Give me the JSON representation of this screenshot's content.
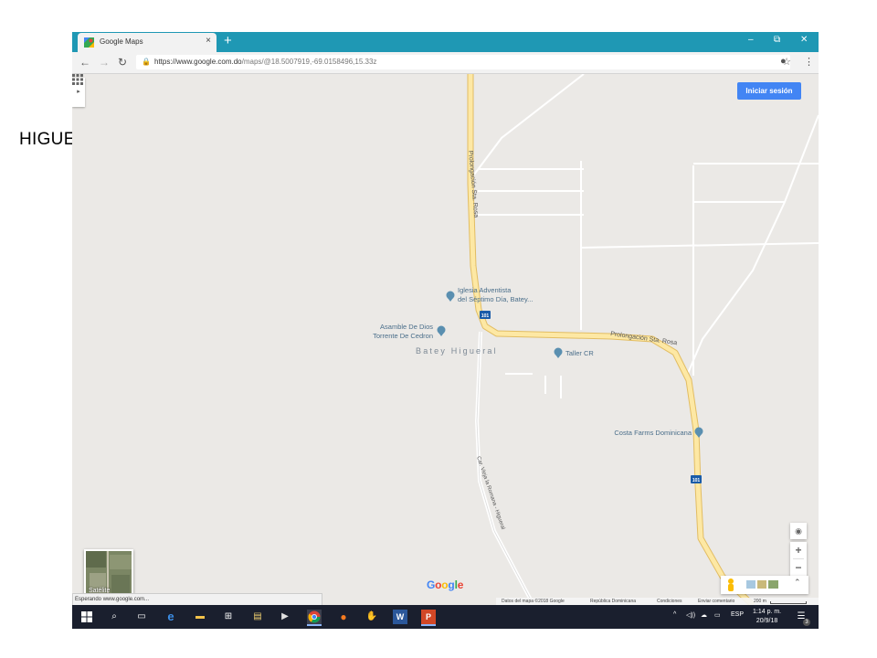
{
  "slide": {
    "title": "HIGUERAL"
  },
  "browser": {
    "tab_title": "Google Maps",
    "tab_close": "×",
    "new_tab": "+",
    "window_controls": {
      "minimize": "–",
      "restore": "⧉",
      "close": "✕"
    },
    "url_host": "https://www.google.com.do",
    "url_rest": "/maps/@18.5007919,-69.0158496,15.33z",
    "status_text": "Esperando www.google.com..."
  },
  "map": {
    "signin_label": "Iniciar sesión",
    "satellite_label": "Satélite",
    "google_logo": "Google",
    "labels": {
      "road_west": "Prolongación Sta. Rosa",
      "road_east": "Prolongación Sta. Rosa",
      "church_line1": "Iglesia Adventista",
      "church_line2": "del Séptimo Día, Batey...",
      "asamble_line1": "Asamble De Dios",
      "asamble_line2": "Torrente De Cedron",
      "batey": "Batey Higueral",
      "taller": "Taller CR",
      "costa": "Costa Farms Dominicana",
      "car_vieja": "Car. Vieja la Romana - Higueral",
      "shield_101": "101"
    },
    "controls": {
      "zoom_in": "+",
      "zoom_out": "−",
      "locate": "◉",
      "expand_layers": "⌃"
    },
    "footer": {
      "data": "Datos del mapa ©2018 Google",
      "country": "República Dominicana",
      "terms": "Condiciones",
      "feedback": "Enviar comentario",
      "scale": "200 m"
    }
  },
  "taskbar": {
    "lang": "ESP",
    "time": "1:14 p. m.",
    "date": "20/9/18",
    "notif_count": "3"
  },
  "colors": {
    "tab_bar": "#1f98b4",
    "map_bg": "#ebe9e6",
    "road_highway": "#fce8a0",
    "road_edge": "#e8c36a",
    "signin": "#4285f4",
    "poi_pin": "#5a8fb0"
  }
}
